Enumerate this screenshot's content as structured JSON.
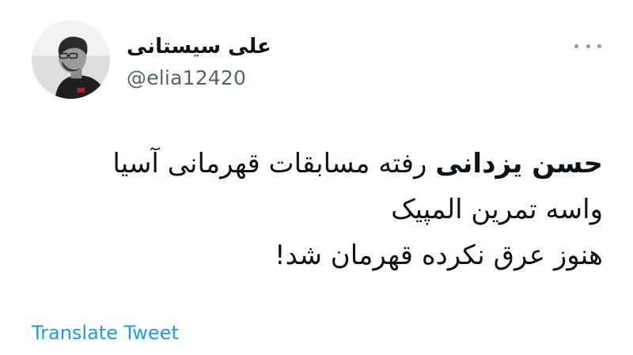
{
  "tweet": {
    "author": {
      "display_name": "علی سیستانی",
      "handle": "@elia12420"
    },
    "more_icon": "more-horizontal-icon",
    "body": {
      "line1_bold": "حسن یزدانی",
      "line1_rest": " رفته مسابقات قهرمانی آسیا",
      "line2": "واسه تمرین المپیک",
      "line3": "هنوز عرق نکرده قهرمان شد!"
    },
    "translate_label": "Translate Tweet",
    "colors": {
      "link": "#1d9bf0",
      "secondary_text": "#536471",
      "primary_text": "#0f1419"
    }
  }
}
